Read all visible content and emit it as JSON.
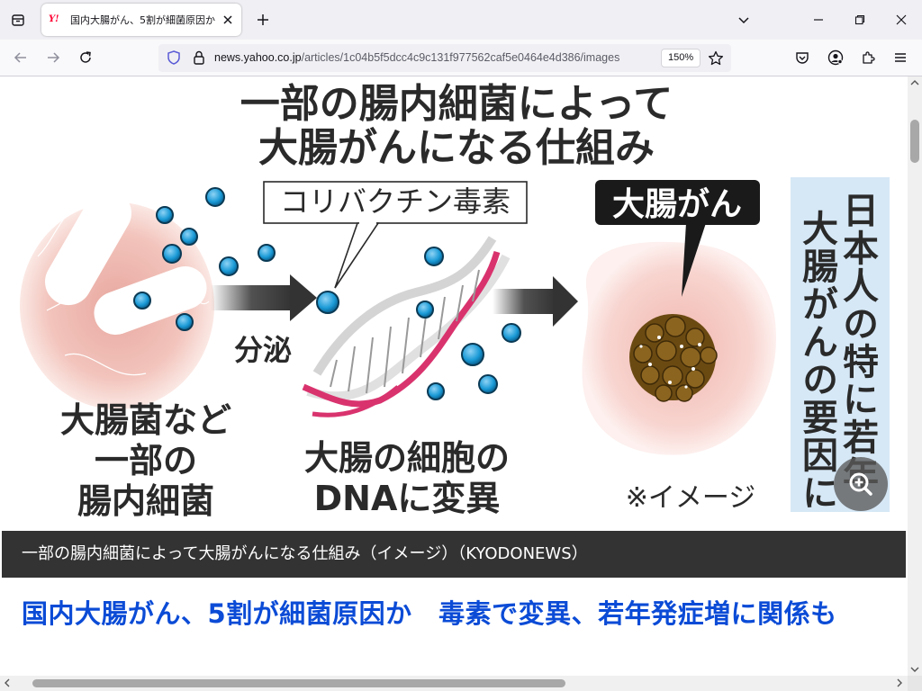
{
  "browser": {
    "tab": {
      "title": "国内大腸がん、5割が細菌原因か",
      "favicon_text": "Y!"
    },
    "url": {
      "domain": "news.yahoo.co.jp",
      "path": "/articles/1c04b5f5dcc4c9c131f977562caf5e0464e4d386/images"
    },
    "zoom": "150%"
  },
  "figure": {
    "title_line1": "一部の腸内細菌によって",
    "title_line2": "大腸がんになる仕組み",
    "toxin_label": "コリバクチン毒素",
    "cancer_label": "大腸がん",
    "secrete_label": "分泌",
    "bacteria_label": [
      "大腸菌など",
      "一部の",
      "腸内細菌"
    ],
    "dna_label": [
      "大腸の細胞の",
      "DNAに変異"
    ],
    "image_note": "※イメージ",
    "side_text": [
      "日本人の特に若年",
      "大腸がんの要因に"
    ]
  },
  "caption": "一部の腸内細菌によって大腸がんになる仕組み（イメージ）（KYODONEWS）",
  "headline": "国内大腸がん、5割が細菌原因か　毒素で変異、若年発症増に関係も",
  "colors": {
    "headline": "#0b4bd6",
    "caption_bg": "#333333",
    "toxin_dot": "#1a9ad6",
    "dna_pink": "#d9336e",
    "tumor": "#6b4a12",
    "side_panel": "#d6e8f6"
  },
  "icons": [
    "tab-list-icon",
    "close-icon",
    "plus-icon",
    "chevron-down-icon",
    "minimize-icon",
    "maximize-icon",
    "back-icon",
    "forward-icon",
    "reload-icon",
    "shield-icon",
    "lock-icon",
    "star-icon",
    "pocket-icon",
    "account-icon",
    "extensions-icon",
    "menu-icon",
    "zoom-in-icon"
  ]
}
